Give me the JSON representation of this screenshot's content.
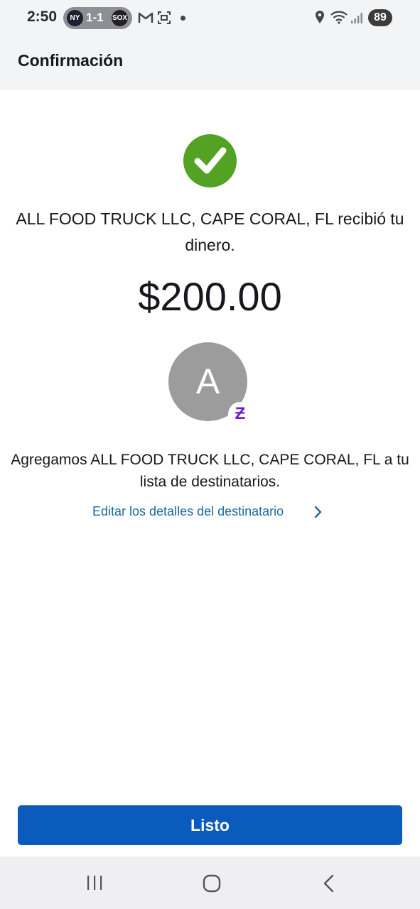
{
  "status_bar": {
    "time": "2:50",
    "score": "1-1",
    "team_left": "NY",
    "team_right": "SOX",
    "battery": "89"
  },
  "header": {
    "title": "Confirmación"
  },
  "confirmation": {
    "message": "ALL FOOD TRUCK LLC, CAPE CORAL, FL recibió tu dinero.",
    "amount": "$200.00",
    "avatar_initial": "A",
    "badge_symbol": "Ƶ",
    "added_text": "Agregamos ALL FOOD TRUCK LLC, CAPE CORAL, FL a tu lista de destinatarios.",
    "edit_link_label": "Editar los detalles del destinatario"
  },
  "actions": {
    "done_label": "Listo"
  },
  "colors": {
    "success": "#54a224",
    "primary_button": "#0b5bbd",
    "link": "#1b6aa0",
    "zelle_purple": "#6d1ed4"
  },
  "icons": [
    "check-icon",
    "chevron-right-icon",
    "location-icon",
    "wifi-icon",
    "signal-icon",
    "gmail-icon",
    "screenshot-icon",
    "recents-icon",
    "home-icon",
    "back-icon"
  ]
}
